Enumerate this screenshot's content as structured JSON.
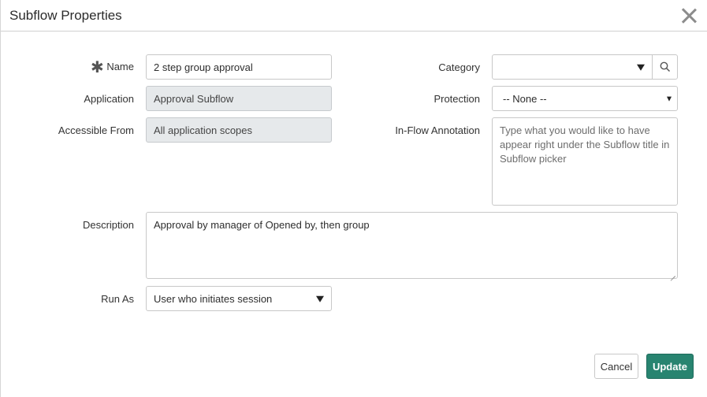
{
  "dialog": {
    "title": "Subflow Properties"
  },
  "form": {
    "required_marker": "✱",
    "name": {
      "label": "Name",
      "value": "2 step group approval"
    },
    "application": {
      "label": "Application",
      "value": "Approval Subflow"
    },
    "accessible_from": {
      "label": "Accessible From",
      "value": "All application scopes"
    },
    "category": {
      "label": "Category",
      "value": ""
    },
    "protection": {
      "label": "Protection",
      "value": "-- None --"
    },
    "in_flow_annotation": {
      "label": "In-Flow Annotation",
      "placeholder": "Type what you would like to have appear right under the Subflow title in Subflow picker"
    },
    "description": {
      "label": "Description",
      "value": "Approval by manager of Opened by, then group"
    },
    "run_as": {
      "label": "Run As",
      "value": "User who initiates session"
    }
  },
  "footer": {
    "cancel_label": "Cancel",
    "update_label": "Update"
  },
  "colors": {
    "primary_button": "#288470",
    "readonly_field": "#e6e9eb"
  },
  "icons": {
    "close": "close-icon",
    "search": "search-icon",
    "dropdown": "chevron-down-icon"
  }
}
